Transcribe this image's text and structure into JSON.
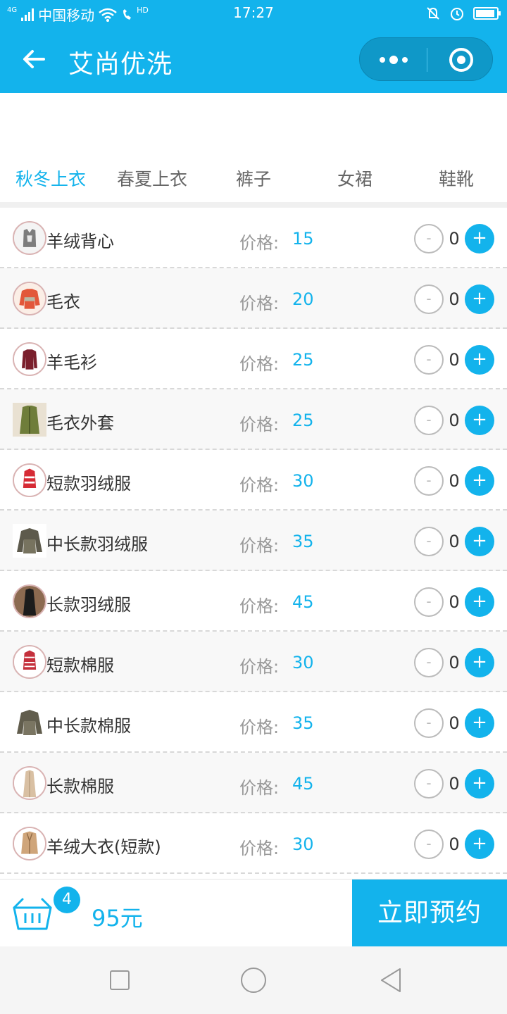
{
  "status_bar": {
    "network_tag": "4G",
    "carrier": "中国移动",
    "hd_tag": "HD",
    "time": "17:27"
  },
  "nav": {
    "title": "艾尚优洗"
  },
  "tabs": [
    "秋冬上衣",
    "春夏上衣",
    "裤子",
    "女裙",
    "鞋靴"
  ],
  "active_tab": 0,
  "price_label": "价格:",
  "minus_label": "-",
  "plus_label": "+",
  "items": [
    {
      "name": "羊绒背心",
      "price": "15",
      "qty": "0",
      "icon": "vest-icon"
    },
    {
      "name": "毛衣",
      "price": "20",
      "qty": "0",
      "icon": "sweater-icon"
    },
    {
      "name": "羊毛衫",
      "price": "25",
      "qty": "0",
      "icon": "wool-shirt-icon"
    },
    {
      "name": "毛衣外套",
      "price": "25",
      "qty": "0",
      "icon": "cardigan-icon"
    },
    {
      "name": "短款羽绒服",
      "price": "30",
      "qty": "0",
      "icon": "short-down-jacket-icon"
    },
    {
      "name": "中长款羽绒服",
      "price": "35",
      "qty": "0",
      "icon": "mid-down-jacket-icon"
    },
    {
      "name": "长款羽绒服",
      "price": "45",
      "qty": "0",
      "icon": "long-down-jacket-icon"
    },
    {
      "name": "短款棉服",
      "price": "30",
      "qty": "0",
      "icon": "short-cotton-coat-icon"
    },
    {
      "name": "中长款棉服",
      "price": "35",
      "qty": "0",
      "icon": "mid-cotton-coat-icon"
    },
    {
      "name": "长款棉服",
      "price": "45",
      "qty": "0",
      "icon": "long-cotton-coat-icon"
    },
    {
      "name": "羊绒大衣(短款)",
      "price": "30",
      "qty": "0",
      "icon": "cashmere-coat-icon"
    }
  ],
  "cart": {
    "count": "4",
    "total": "95元",
    "book_label": "立即预约"
  },
  "colors": {
    "accent": "#13b3ec"
  }
}
